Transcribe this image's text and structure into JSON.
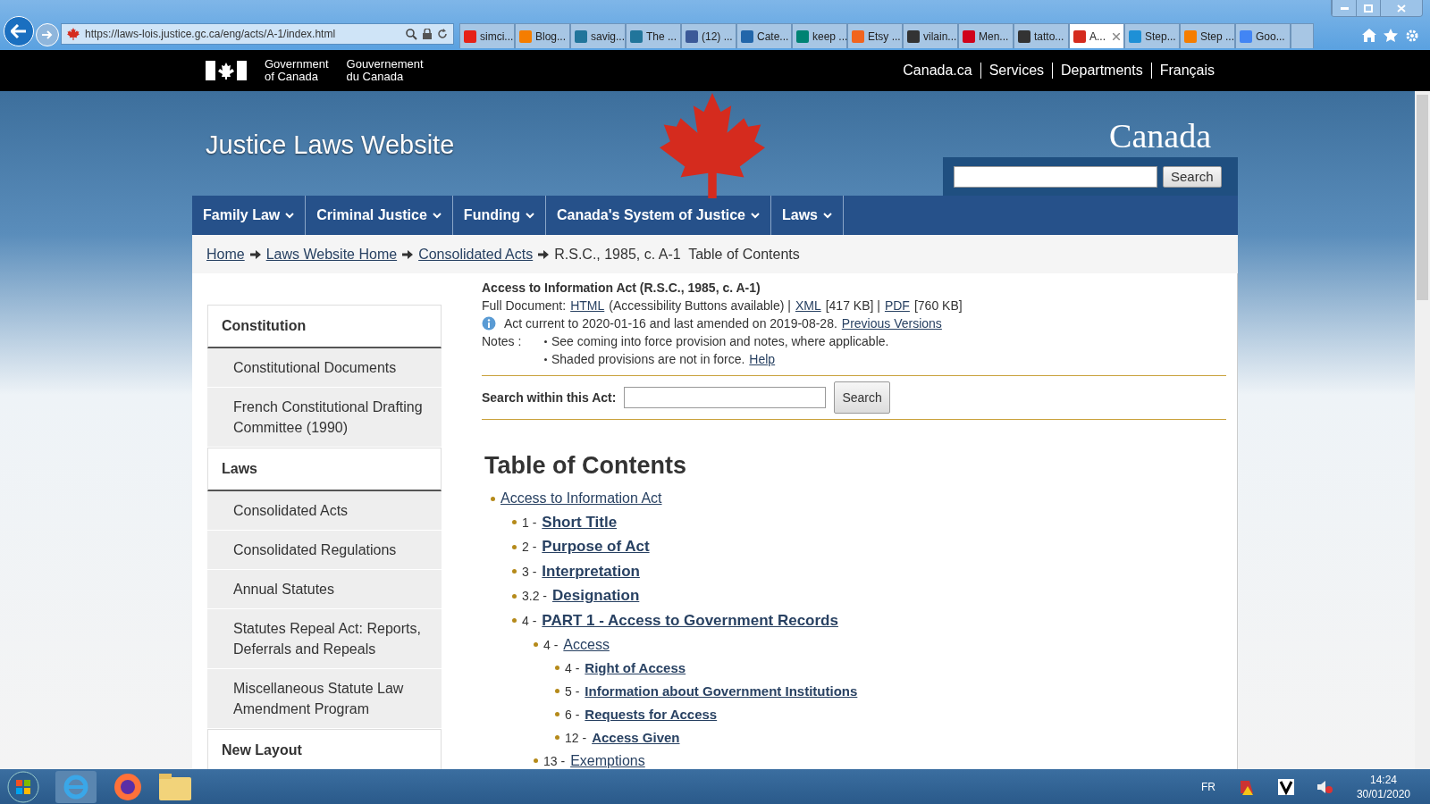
{
  "browser": {
    "address": "https://laws-lois.justice.gc.ca/eng/acts/A-1/index.html",
    "tabs": [
      {
        "label": "simci...",
        "selected": false,
        "color": "#e62117"
      },
      {
        "label": "Blog...",
        "selected": false,
        "color": "#f57d00"
      },
      {
        "label": "savig...",
        "selected": false,
        "color": "#21759b"
      },
      {
        "label": "The ...",
        "selected": false,
        "color": "#21759b"
      },
      {
        "label": "(12) ...",
        "selected": false,
        "color": "#3b5998"
      },
      {
        "label": "Cate...",
        "selected": false,
        "color": "#2266aa"
      },
      {
        "label": "keep ...",
        "selected": false,
        "color": "#008373"
      },
      {
        "label": "Etsy ...",
        "selected": false,
        "color": "#f1641e"
      },
      {
        "label": "vilain...",
        "selected": false,
        "color": "#333333"
      },
      {
        "label": "Men...",
        "selected": false,
        "color": "#d0021b"
      },
      {
        "label": "tatto...",
        "selected": false,
        "color": "#333333"
      },
      {
        "label": "A...",
        "selected": true,
        "color": "#d52b1e"
      },
      {
        "label": "Step...",
        "selected": false,
        "color": "#1e90d6"
      },
      {
        "label": "Step ...",
        "selected": false,
        "color": "#f57d00"
      },
      {
        "label": "Goo...",
        "selected": false,
        "color": "#4285f4"
      }
    ]
  },
  "gov_bar": {
    "name_en": "Government\nof Canada",
    "name_fr": "Gouvernement\ndu Canada",
    "links": [
      "Canada.ca",
      "Services",
      "Departments",
      "Français"
    ]
  },
  "banner": {
    "title": "Justice Laws Website",
    "wordmark": "Canada",
    "search_button": "Search"
  },
  "nav": [
    "Family Law",
    "Criminal Justice",
    "Funding",
    "Canada's System of Justice",
    "Laws"
  ],
  "breadcrumb": {
    "links": [
      "Home",
      "Laws Website Home",
      "Consolidated Acts"
    ],
    "current": "R.S.C., 1985, c. A-1  Table of Contents"
  },
  "sidebar": [
    {
      "heading": "Constitution",
      "items": [
        "Constitutional Documents",
        "French Constitutional Drafting Committee (1990)"
      ]
    },
    {
      "heading": "Laws",
      "items": [
        "Consolidated Acts",
        "Consolidated Regulations",
        "Annual Statutes",
        "Statutes Repeal Act: Reports, Deferrals and Repeals",
        "Miscellaneous Statute Law Amendment Program"
      ]
    },
    {
      "heading": "New Layout"
    }
  ],
  "act": {
    "title": "Access to Information Act (R.S.C., 1985, c. A-1)",
    "full_document_label": "Full Document:",
    "formats": [
      {
        "link": "HTML",
        "note": "(Accessibility Buttons available) |"
      },
      {
        "link": "XML",
        "note": "[417 KB] |"
      },
      {
        "link": "PDF",
        "note": "[760 KB]"
      }
    ],
    "currency": "Act current to 2020-01-16 and last amended on 2019-08-28.",
    "currency_link": "Previous Versions",
    "notes_label": "Notes :",
    "notes": [
      {
        "text": "See coming into force provision and notes, where applicable."
      },
      {
        "text": "Shaded provisions are not in force.",
        "link": "Help"
      }
    ],
    "search_label": "Search within this Act:",
    "search_button": "Search"
  },
  "toc": {
    "title": "Table of Contents",
    "items": [
      {
        "label": "Access to Information Act",
        "kind": "division",
        "children": [
          {
            "number": "1 -",
            "label": "Short Title",
            "kind": "provision"
          },
          {
            "number": "2 -",
            "label": "Purpose of Act",
            "kind": "provision"
          },
          {
            "number": "3 -",
            "label": "Interpretation",
            "kind": "provision"
          },
          {
            "number": "3.2 -",
            "label": "Designation",
            "kind": "provision"
          },
          {
            "number": "4 -",
            "label": "PART 1 - Access to Government Records",
            "kind": "provision",
            "children": [
              {
                "number": "4 -",
                "label": "Access",
                "kind": "division",
                "children": [
                  {
                    "number": "4 -",
                    "label": "Right of Access",
                    "kind": "provision"
                  },
                  {
                    "number": "5 -",
                    "label": "Information about Government Institutions",
                    "kind": "provision"
                  },
                  {
                    "number": "6 -",
                    "label": "Requests for Access",
                    "kind": "provision"
                  },
                  {
                    "number": "12 -",
                    "label": "Access Given",
                    "kind": "provision"
                  }
                ]
              },
              {
                "number": "13 -",
                "label": "Exemptions",
                "kind": "division"
              }
            ]
          }
        ]
      }
    ]
  },
  "taskbar": {
    "language": "FR",
    "time": "14:24",
    "date": "30/01/2020"
  }
}
